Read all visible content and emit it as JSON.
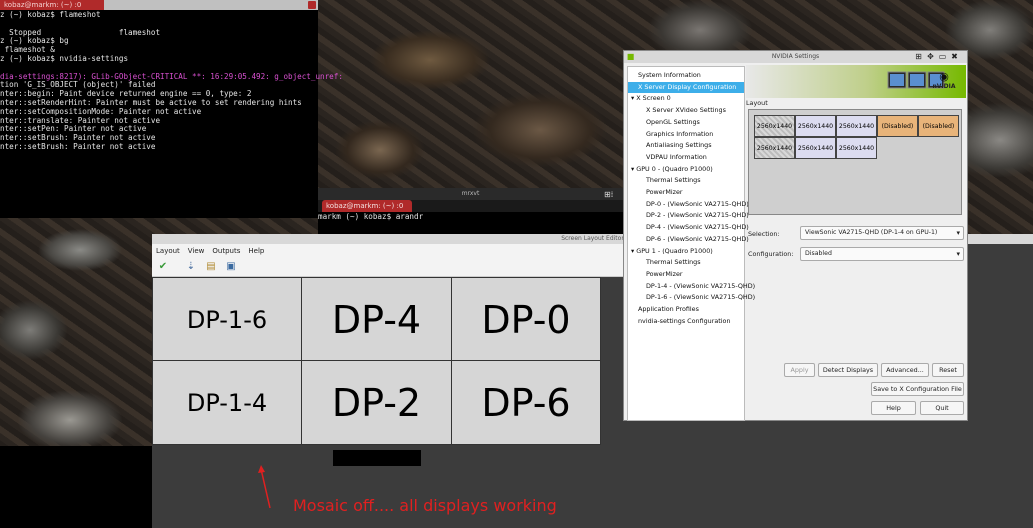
{
  "left_terminal": {
    "tab_label": "kobaz@markm: (~) :0",
    "lines": [
      "z (~) kobaz$ flameshot",
      "",
      "  Stopped                 flameshot",
      "z (~) kobaz$ bg",
      " flameshot &",
      "z (~) kobaz$ nvidia-settings",
      "",
      "dia-settings:8217): GLib-GObject-CRITICAL **: 16:29:05.492: g_object_unref:",
      "tion 'G_IS_OBJECT (object)' failed",
      "nter::begin: Paint device returned engine == 0, type: 2",
      "nter::setRenderHint: Painter must be active to set rendering hints",
      "nter::setCompositionMode: Painter not active",
      "nter::translate: Painter not active",
      "nter::setPen: Painter not active",
      "nter::setBrush: Painter not active",
      "nter::setBrush: Painter not active"
    ]
  },
  "mid_terminal": {
    "window_title": "mrxvt",
    "tab_label": "kobaz@markm: (~) :0",
    "prompt": "markm (~) kobaz$ arandr"
  },
  "arandr": {
    "window_title": "Screen Layout Editor",
    "menu": [
      "Layout",
      "View",
      "Outputs",
      "Help"
    ],
    "toolbar_icons": [
      "apply-checkmark-icon",
      "open-layout-icon",
      "folder-icon",
      "save-icon"
    ],
    "monitors_row1": [
      "DP-1-6",
      "DP-4",
      "DP-0"
    ],
    "monitors_row2": [
      "DP-1-4",
      "DP-2",
      "DP-6"
    ]
  },
  "nvidia": {
    "window_title": "NVIDIA Settings",
    "logo_text": "nVIDIA",
    "tree": [
      {
        "label": "System Information",
        "level": 1,
        "selected": false
      },
      {
        "label": "X Server Display Configuration",
        "level": 1,
        "selected": true
      },
      {
        "label": "▾ X Screen 0",
        "level": 0,
        "selected": false
      },
      {
        "label": "X Server XVideo Settings",
        "level": 2,
        "selected": false
      },
      {
        "label": "OpenGL Settings",
        "level": 2,
        "selected": false
      },
      {
        "label": "Graphics Information",
        "level": 2,
        "selected": false
      },
      {
        "label": "Antialiasing Settings",
        "level": 2,
        "selected": false
      },
      {
        "label": "VDPAU Information",
        "level": 2,
        "selected": false
      },
      {
        "label": "▾ GPU 0 - (Quadro P1000)",
        "level": 0,
        "selected": false
      },
      {
        "label": "Thermal Settings",
        "level": 2,
        "selected": false
      },
      {
        "label": "PowerMizer",
        "level": 2,
        "selected": false
      },
      {
        "label": "DP-0 - (ViewSonic VA2715-QHD)",
        "level": 2,
        "selected": false
      },
      {
        "label": "DP-2 - (ViewSonic VA2715-QHD)",
        "level": 2,
        "selected": false
      },
      {
        "label": "DP-4 - (ViewSonic VA2715-QHD)",
        "level": 2,
        "selected": false
      },
      {
        "label": "DP-6 - (ViewSonic VA2715-QHD)",
        "level": 2,
        "selected": false
      },
      {
        "label": "▾ GPU 1 - (Quadro P1000)",
        "level": 0,
        "selected": false
      },
      {
        "label": "Thermal Settings",
        "level": 2,
        "selected": false
      },
      {
        "label": "PowerMizer",
        "level": 2,
        "selected": false
      },
      {
        "label": "DP-1-4 - (ViewSonic VA2715-QHD)",
        "level": 2,
        "selected": false
      },
      {
        "label": "DP-1-6 - (ViewSonic VA2715-QHD)",
        "level": 2,
        "selected": false
      },
      {
        "label": "Application Profiles",
        "level": 1,
        "selected": false
      },
      {
        "label": "nvidia-settings Configuration",
        "level": 1,
        "selected": false
      }
    ],
    "layout_label": "Layout",
    "layout_row1": [
      {
        "text": "2560x1440",
        "style": "hatched"
      },
      {
        "text": "2560x1440",
        "style": "normal"
      },
      {
        "text": "2560x1440",
        "style": "normal"
      },
      {
        "text": "(Disabled)",
        "style": "disabled"
      },
      {
        "text": "(Disabled)",
        "style": "disabled"
      }
    ],
    "layout_row2": [
      {
        "text": "2560x1440",
        "style": "hatched"
      },
      {
        "text": "2560x1440",
        "style": "normal"
      },
      {
        "text": "2560x1440",
        "style": "normal"
      }
    ],
    "selection_label": "Selection:",
    "selection_value": "ViewSonic VA2715-QHD (DP-1-4 on GPU-1)",
    "configuration_label": "Configuration:",
    "configuration_value": "Disabled",
    "buttons": {
      "apply": "Apply",
      "detect": "Detect Displays",
      "advanced": "Advanced...",
      "reset": "Reset",
      "save": "Save to X Configuration File",
      "help": "Help",
      "quit": "Quit"
    },
    "colors": {
      "accent": "#3daee9",
      "nvidia_green": "#76b900",
      "disabled_cell": "#e8b47a"
    }
  },
  "annotation": {
    "text": "Mosaic off.... all displays working",
    "color": "#e02020"
  }
}
